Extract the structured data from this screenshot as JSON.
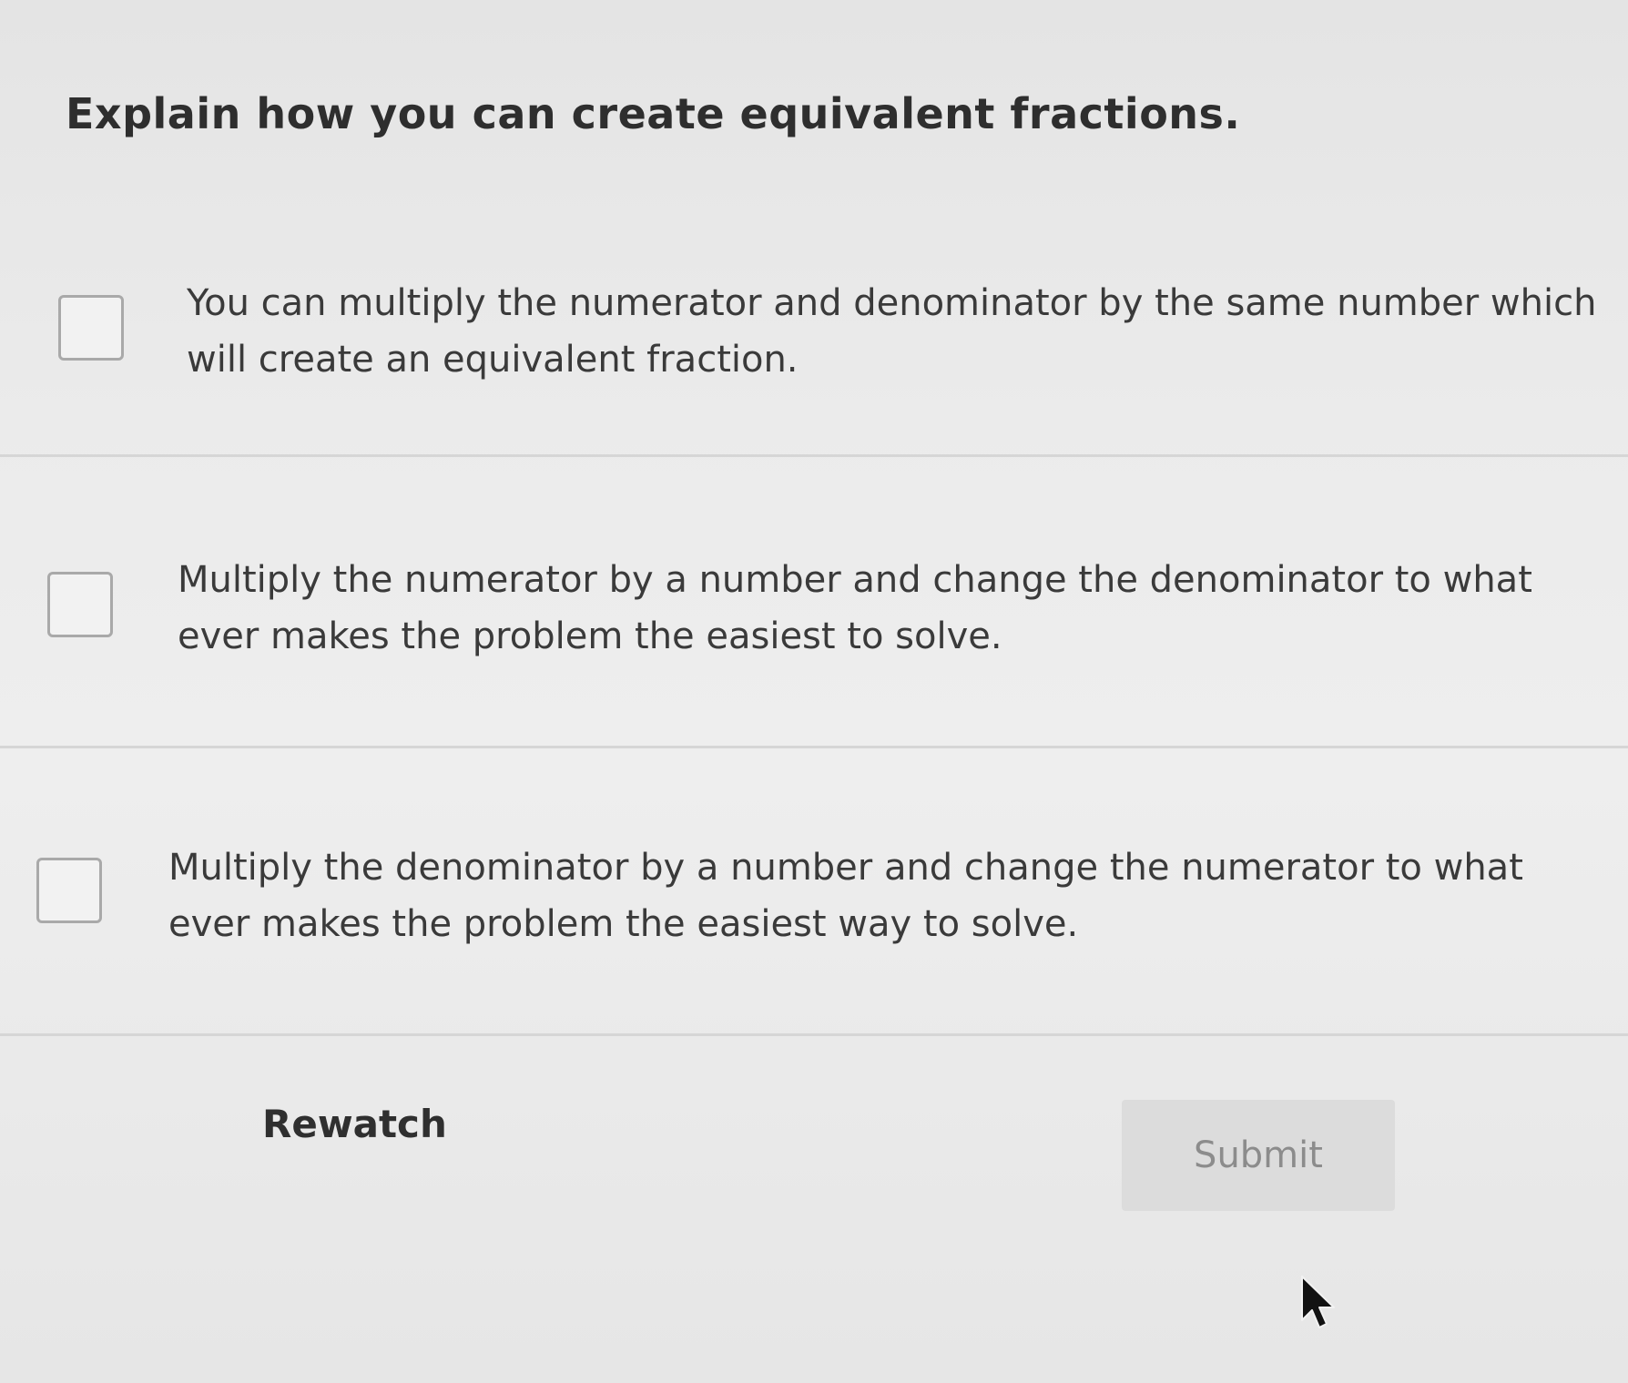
{
  "question": {
    "text": "Explain how you can create equivalent fractions."
  },
  "options": [
    {
      "text": "You can multiply the numerator and denominator by the same number which will create an equivalent fraction.",
      "checked": false
    },
    {
      "text": "Multiply the numerator by a number and change the denominator to what ever makes the problem the easiest to solve.",
      "checked": false
    },
    {
      "text": "Multiply the denominator by a number and change the numerator to what ever makes the problem the easiest way to solve.",
      "checked": false
    }
  ],
  "actions": {
    "rewatch_label": "Rewatch",
    "submit_label": "Submit"
  },
  "icons": {
    "cursor": "mouse-pointer-icon"
  }
}
